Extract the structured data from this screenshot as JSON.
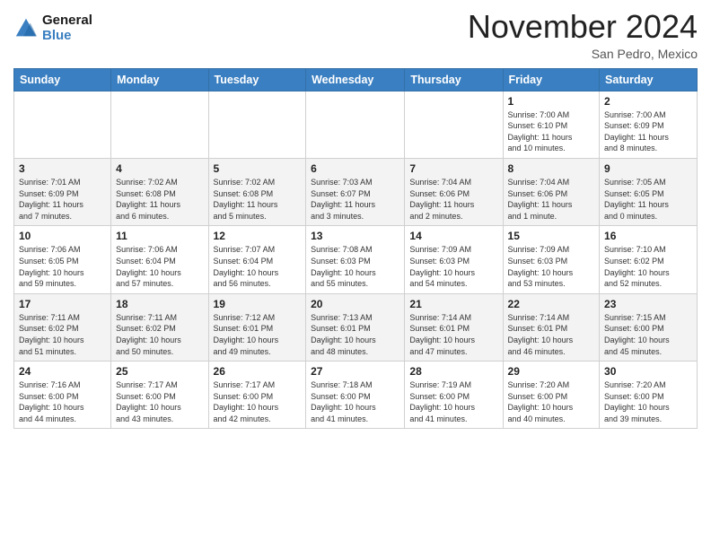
{
  "header": {
    "logo_general": "General",
    "logo_blue": "Blue",
    "month_title": "November 2024",
    "location": "San Pedro, Mexico"
  },
  "weekdays": [
    "Sunday",
    "Monday",
    "Tuesday",
    "Wednesday",
    "Thursday",
    "Friday",
    "Saturday"
  ],
  "weeks": [
    [
      {
        "day": "",
        "info": ""
      },
      {
        "day": "",
        "info": ""
      },
      {
        "day": "",
        "info": ""
      },
      {
        "day": "",
        "info": ""
      },
      {
        "day": "",
        "info": ""
      },
      {
        "day": "1",
        "info": "Sunrise: 7:00 AM\nSunset: 6:10 PM\nDaylight: 11 hours\nand 10 minutes."
      },
      {
        "day": "2",
        "info": "Sunrise: 7:00 AM\nSunset: 6:09 PM\nDaylight: 11 hours\nand 8 minutes."
      }
    ],
    [
      {
        "day": "3",
        "info": "Sunrise: 7:01 AM\nSunset: 6:09 PM\nDaylight: 11 hours\nand 7 minutes."
      },
      {
        "day": "4",
        "info": "Sunrise: 7:02 AM\nSunset: 6:08 PM\nDaylight: 11 hours\nand 6 minutes."
      },
      {
        "day": "5",
        "info": "Sunrise: 7:02 AM\nSunset: 6:08 PM\nDaylight: 11 hours\nand 5 minutes."
      },
      {
        "day": "6",
        "info": "Sunrise: 7:03 AM\nSunset: 6:07 PM\nDaylight: 11 hours\nand 3 minutes."
      },
      {
        "day": "7",
        "info": "Sunrise: 7:04 AM\nSunset: 6:06 PM\nDaylight: 11 hours\nand 2 minutes."
      },
      {
        "day": "8",
        "info": "Sunrise: 7:04 AM\nSunset: 6:06 PM\nDaylight: 11 hours\nand 1 minute."
      },
      {
        "day": "9",
        "info": "Sunrise: 7:05 AM\nSunset: 6:05 PM\nDaylight: 11 hours\nand 0 minutes."
      }
    ],
    [
      {
        "day": "10",
        "info": "Sunrise: 7:06 AM\nSunset: 6:05 PM\nDaylight: 10 hours\nand 59 minutes."
      },
      {
        "day": "11",
        "info": "Sunrise: 7:06 AM\nSunset: 6:04 PM\nDaylight: 10 hours\nand 57 minutes."
      },
      {
        "day": "12",
        "info": "Sunrise: 7:07 AM\nSunset: 6:04 PM\nDaylight: 10 hours\nand 56 minutes."
      },
      {
        "day": "13",
        "info": "Sunrise: 7:08 AM\nSunset: 6:03 PM\nDaylight: 10 hours\nand 55 minutes."
      },
      {
        "day": "14",
        "info": "Sunrise: 7:09 AM\nSunset: 6:03 PM\nDaylight: 10 hours\nand 54 minutes."
      },
      {
        "day": "15",
        "info": "Sunrise: 7:09 AM\nSunset: 6:03 PM\nDaylight: 10 hours\nand 53 minutes."
      },
      {
        "day": "16",
        "info": "Sunrise: 7:10 AM\nSunset: 6:02 PM\nDaylight: 10 hours\nand 52 minutes."
      }
    ],
    [
      {
        "day": "17",
        "info": "Sunrise: 7:11 AM\nSunset: 6:02 PM\nDaylight: 10 hours\nand 51 minutes."
      },
      {
        "day": "18",
        "info": "Sunrise: 7:11 AM\nSunset: 6:02 PM\nDaylight: 10 hours\nand 50 minutes."
      },
      {
        "day": "19",
        "info": "Sunrise: 7:12 AM\nSunset: 6:01 PM\nDaylight: 10 hours\nand 49 minutes."
      },
      {
        "day": "20",
        "info": "Sunrise: 7:13 AM\nSunset: 6:01 PM\nDaylight: 10 hours\nand 48 minutes."
      },
      {
        "day": "21",
        "info": "Sunrise: 7:14 AM\nSunset: 6:01 PM\nDaylight: 10 hours\nand 47 minutes."
      },
      {
        "day": "22",
        "info": "Sunrise: 7:14 AM\nSunset: 6:01 PM\nDaylight: 10 hours\nand 46 minutes."
      },
      {
        "day": "23",
        "info": "Sunrise: 7:15 AM\nSunset: 6:00 PM\nDaylight: 10 hours\nand 45 minutes."
      }
    ],
    [
      {
        "day": "24",
        "info": "Sunrise: 7:16 AM\nSunset: 6:00 PM\nDaylight: 10 hours\nand 44 minutes."
      },
      {
        "day": "25",
        "info": "Sunrise: 7:17 AM\nSunset: 6:00 PM\nDaylight: 10 hours\nand 43 minutes."
      },
      {
        "day": "26",
        "info": "Sunrise: 7:17 AM\nSunset: 6:00 PM\nDaylight: 10 hours\nand 42 minutes."
      },
      {
        "day": "27",
        "info": "Sunrise: 7:18 AM\nSunset: 6:00 PM\nDaylight: 10 hours\nand 41 minutes."
      },
      {
        "day": "28",
        "info": "Sunrise: 7:19 AM\nSunset: 6:00 PM\nDaylight: 10 hours\nand 41 minutes."
      },
      {
        "day": "29",
        "info": "Sunrise: 7:20 AM\nSunset: 6:00 PM\nDaylight: 10 hours\nand 40 minutes."
      },
      {
        "day": "30",
        "info": "Sunrise: 7:20 AM\nSunset: 6:00 PM\nDaylight: 10 hours\nand 39 minutes."
      }
    ]
  ]
}
